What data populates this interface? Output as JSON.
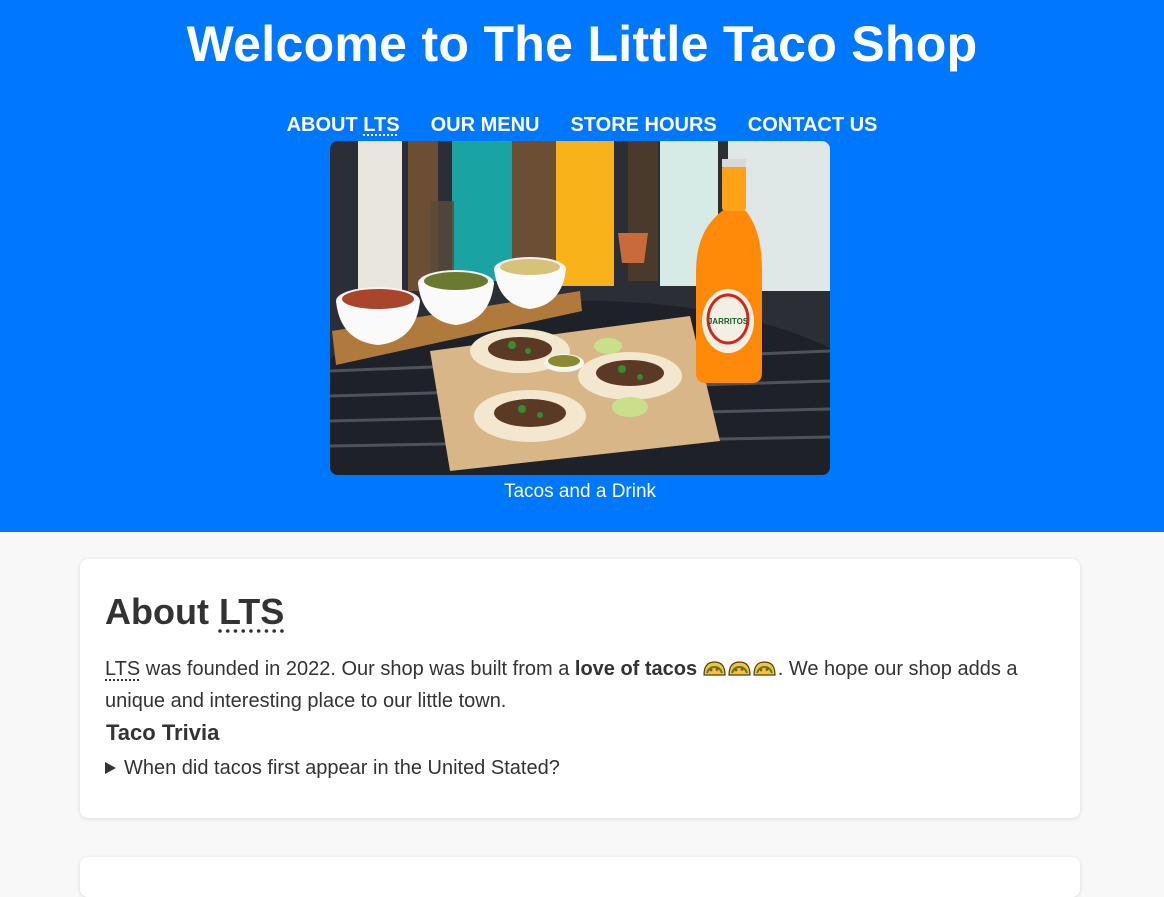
{
  "header": {
    "title": "Welcome to The Little Taco Shop",
    "nav": [
      {
        "label_prefix": "ABOUT ",
        "label_abbr": "LTS"
      },
      {
        "label": "OUR MENU"
      },
      {
        "label": "STORE HOURS"
      },
      {
        "label": "CONTACT US"
      }
    ],
    "hero_caption": "Tacos and a Drink",
    "bottle_label": "JARRITOS"
  },
  "about": {
    "heading_prefix": "About ",
    "heading_abbr": "LTS",
    "para_abbr": "LTS",
    "para_part1": " was founded in 2022. Our shop was built from a ",
    "para_bold": "love of tacos",
    "para_part2": ". We hope our shop adds a unique and interesting place to our little town.",
    "trivia_heading": "Taco Trivia",
    "trivia_question": "When did tacos first appear in the United Stated?"
  },
  "colors": {
    "header_bg": "#0077ff",
    "page_bg": "#f8f8f8",
    "text": "#333333"
  }
}
